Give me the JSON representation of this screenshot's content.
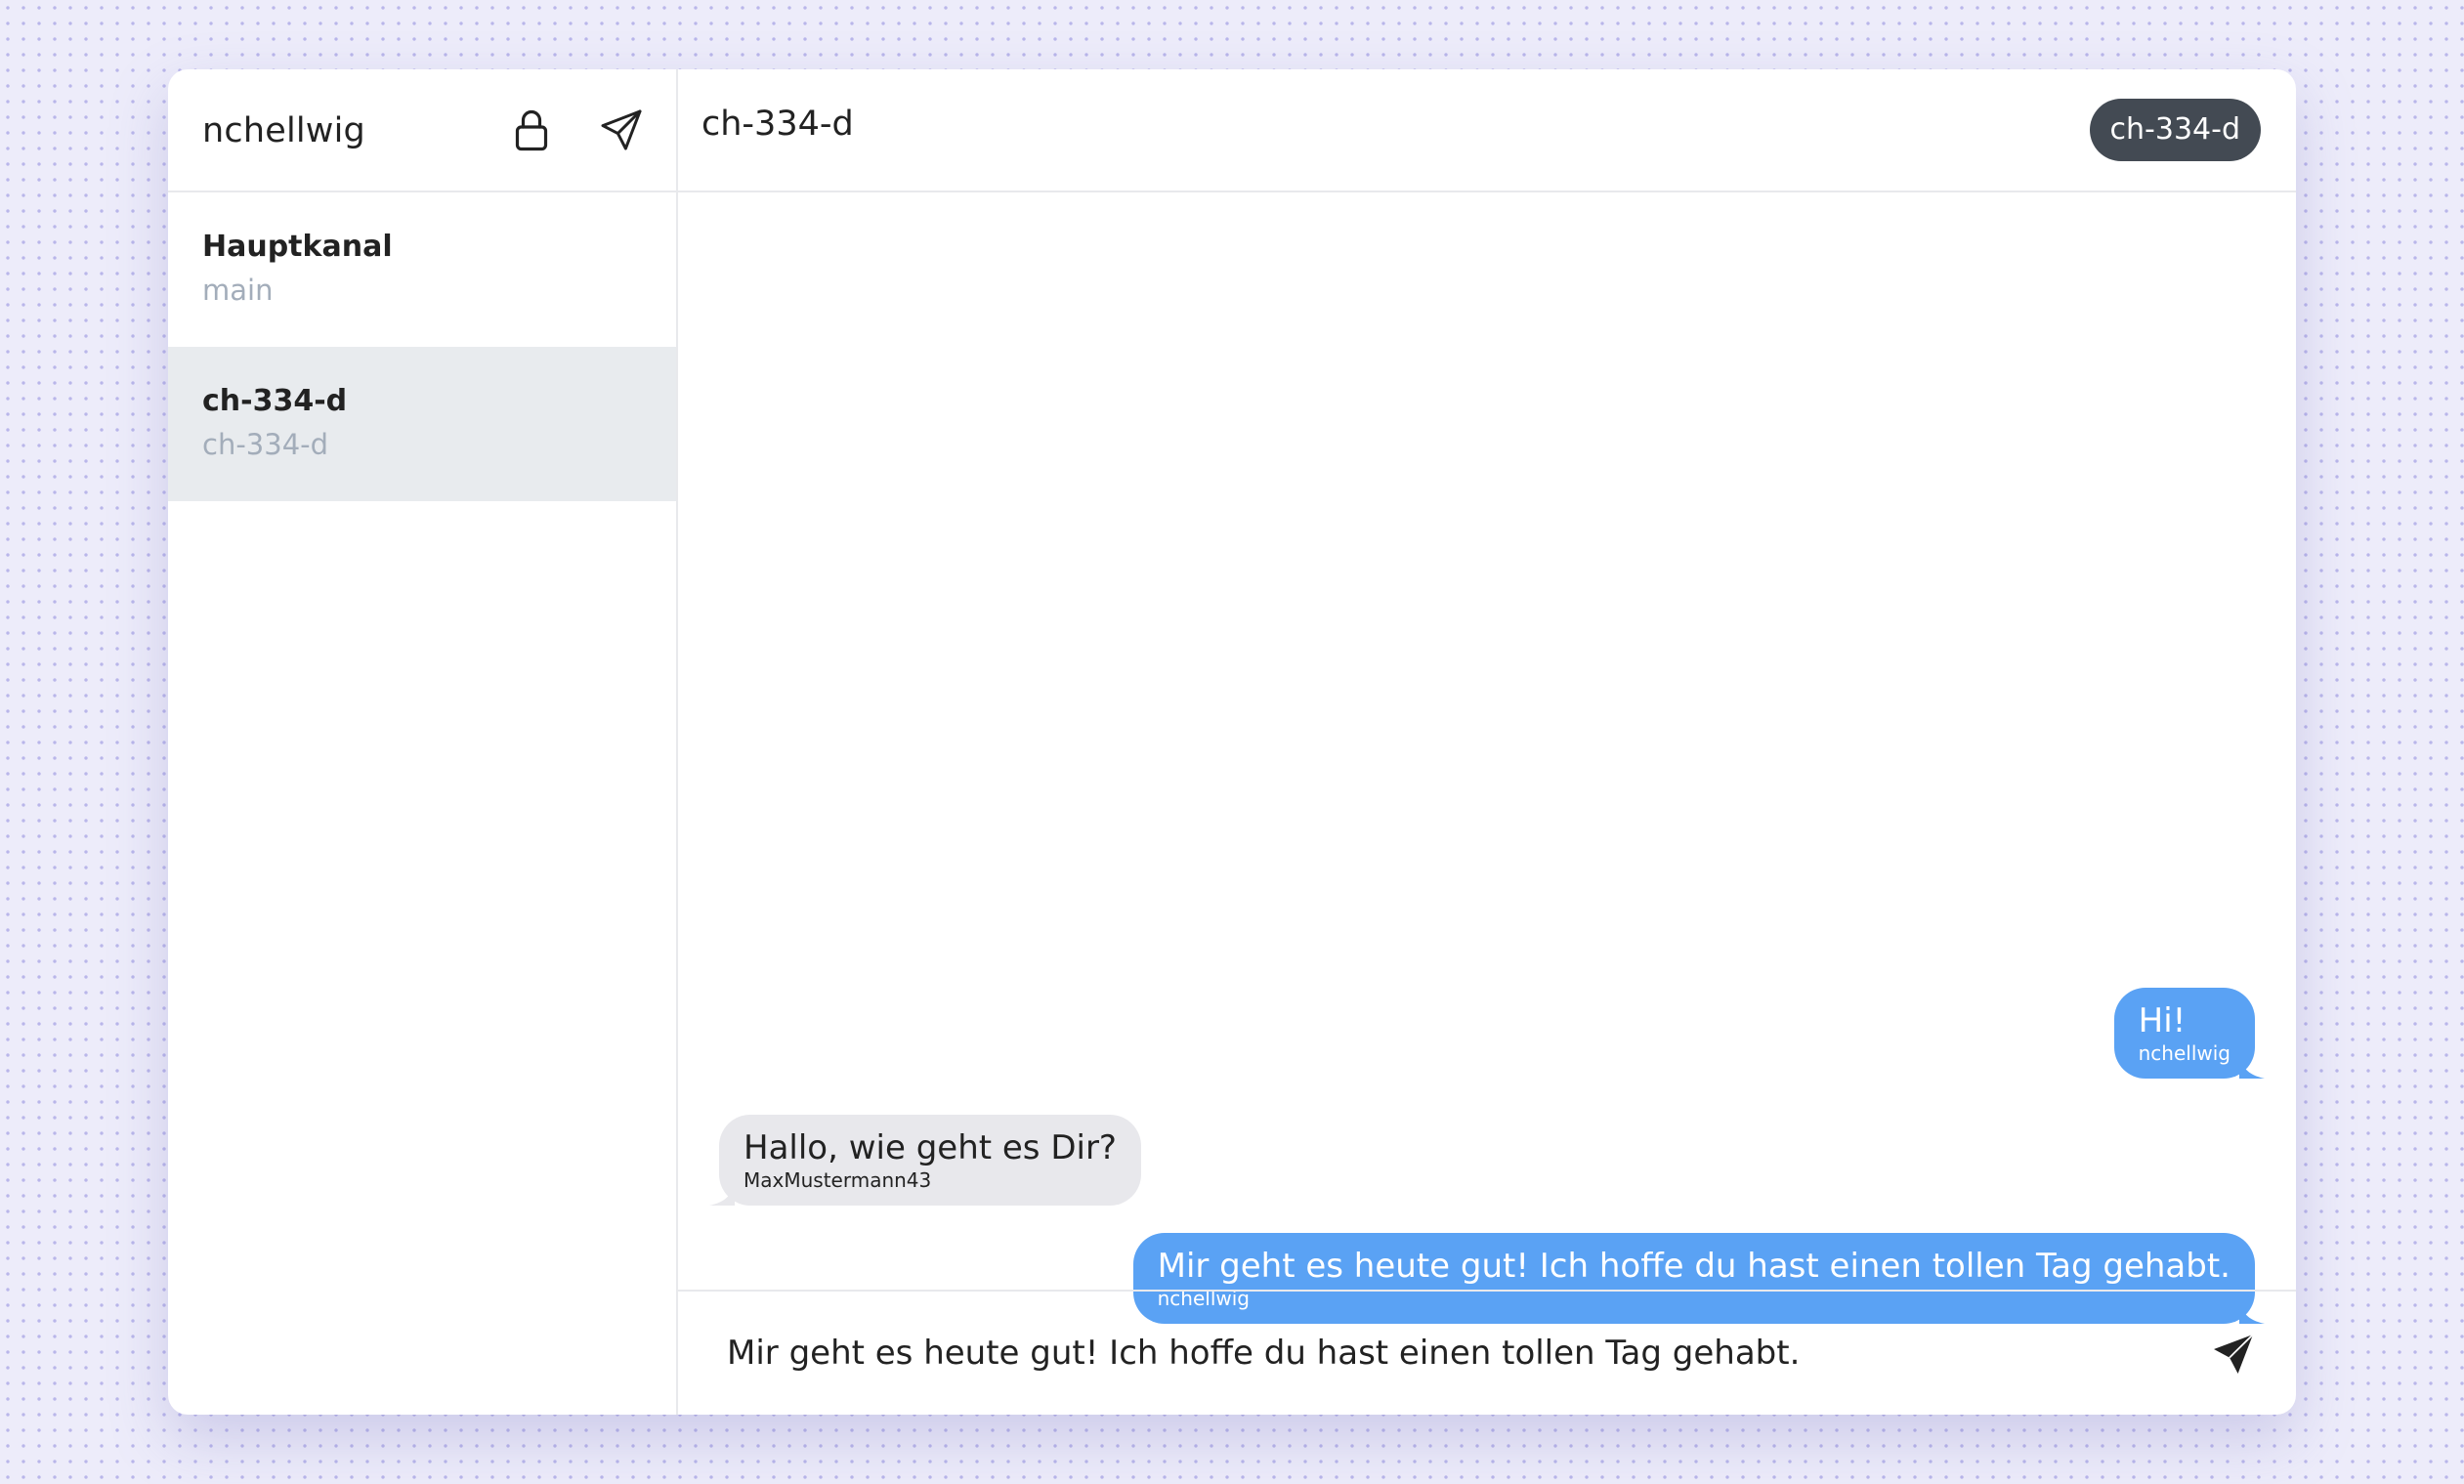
{
  "sidebar": {
    "user_name": "nchellwig",
    "icons": {
      "lock": "lock-icon",
      "send": "paper-plane-icon"
    },
    "channels": [
      {
        "name": "Hauptkanal",
        "id": "main",
        "active": false
      },
      {
        "name": "ch-334-d",
        "id": "ch-334-d",
        "active": true
      }
    ]
  },
  "chat": {
    "title": "ch-334-d",
    "channel_pill": "ch-334-d",
    "messages": [
      {
        "text": "Hi!",
        "author": "nchellwig",
        "direction": "outgoing"
      },
      {
        "text": "Hallo, wie geht es Dir?",
        "author": "MaxMustermann43",
        "direction": "incoming"
      },
      {
        "text": "Mir geht es heute gut! Ich hoffe du hast einen tollen Tag gehabt.",
        "author": "nchellwig",
        "direction": "outgoing"
      }
    ],
    "composer": {
      "value": "Mir geht es heute gut! Ich hoffe du hast einen tollen Tag gehabt.",
      "send_icon": "send-filled-icon"
    }
  },
  "colors": {
    "background": "#edecfa",
    "outgoing_bubble": "#5aa2f4",
    "incoming_bubble": "#e8e8ec",
    "pill": "#434a53",
    "active_channel": "#e8ebee",
    "muted_text": "#a3adba"
  }
}
